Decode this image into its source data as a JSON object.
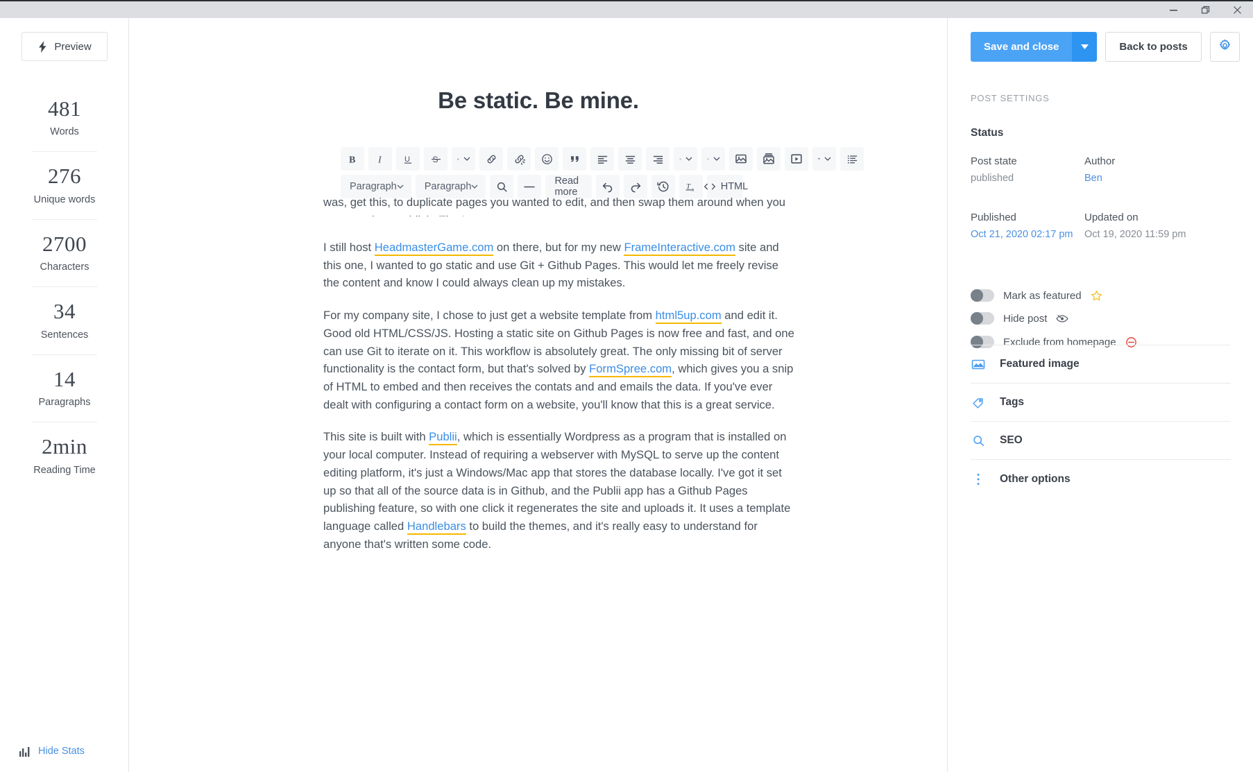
{
  "window": {
    "controls": [
      {
        "name": "minimize",
        "glyph": "minimize-icon"
      },
      {
        "name": "restore",
        "glyph": "restore-icon"
      },
      {
        "name": "close",
        "glyph": "close-icon"
      }
    ]
  },
  "sidebar": {
    "preview_label": "Preview",
    "preview_icon": "lightning-bolt-icon",
    "stats": [
      {
        "value": "481",
        "label": "Words"
      },
      {
        "value": "276",
        "label": "Unique words"
      },
      {
        "value": "2700",
        "label": "Characters"
      },
      {
        "value": "34",
        "label": "Sentences"
      },
      {
        "value": "14",
        "label": "Paragraphs"
      },
      {
        "value": "2min",
        "label": "Reading Time"
      }
    ],
    "hide_stats_label": "Hide Stats",
    "hide_stats_icon": "bar-chart-icon",
    "hide_stats_color": "#4a90e2"
  },
  "editor": {
    "title": "Be static. Be mine.",
    "toolbar": {
      "row1": [
        {
          "name": "bold-button",
          "icon": "bold-icon",
          "label": "B"
        },
        {
          "name": "italic-button",
          "icon": "italic-icon",
          "label": "I"
        },
        {
          "name": "underline-button",
          "icon": "underline-icon",
          "label": "U"
        },
        {
          "name": "strikethrough-button",
          "icon": "strikethrough-icon",
          "label": "S"
        },
        {
          "name": "text-color-button",
          "icon": "text-color-icon",
          "label": "A"
        },
        {
          "name": "insert-link-button",
          "icon": "link-icon",
          "label": ""
        },
        {
          "name": "remove-link-button",
          "icon": "unlink-icon",
          "label": ""
        },
        {
          "name": "emoji-button",
          "icon": "smiley-icon",
          "label": ""
        },
        {
          "name": "blockquote-button",
          "icon": "quote-icon",
          "label": ""
        },
        {
          "name": "align-left-button",
          "icon": "align-left-icon",
          "label": ""
        },
        {
          "name": "align-center-button",
          "icon": "align-center-icon",
          "label": ""
        },
        {
          "name": "align-right-button",
          "icon": "align-right-icon",
          "label": ""
        },
        {
          "name": "bullet-list-button",
          "icon": "bullet-list-icon",
          "label": ""
        },
        {
          "name": "numbered-list-button",
          "icon": "numbered-list-icon",
          "label": ""
        },
        {
          "name": "insert-image-button",
          "icon": "image-icon",
          "label": ""
        },
        {
          "name": "insert-gallery-button",
          "icon": "gallery-icon",
          "label": ""
        },
        {
          "name": "insert-video-button",
          "icon": "video-icon",
          "label": ""
        },
        {
          "name": "insert-table-button",
          "icon": "table-icon",
          "label": ""
        },
        {
          "name": "toc-button",
          "icon": "list-detail-icon",
          "label": ""
        }
      ],
      "row2": {
        "block_format": "Paragraph",
        "text_style": "Paragraph",
        "search_icon": "search-icon",
        "horizontal_rule_icon": "horizontal-rule-icon",
        "read_more_label": "Read more",
        "undo_icon": "undo-icon",
        "redo_icon": "redo-icon",
        "history_icon": "history-clock-icon",
        "clear_formatting_icon": "clear-format-icon",
        "html_label": "HTML",
        "html_icon": "code-brackets-icon"
      }
    },
    "body": {
      "clipped_paragraph": "was, get this, to duplicate pages you wanted to edit, and then swap them around when you were ready to publish. That's crazy.",
      "paragraphs": [
        {
          "runs": [
            {
              "t": "I still host "
            },
            {
              "t": "HeadmasterGame.com",
              "link": true
            },
            {
              "t": " on there, but for my new "
            },
            {
              "t": "FrameInteractive.com",
              "link": true
            },
            {
              "t": " site and this one, I wanted to go static and use Git + Github Pages. This would let me freely revise the content and know I could always clean up my mistakes."
            }
          ]
        },
        {
          "runs": [
            {
              "t": "For my company site, I chose to just get a website template from "
            },
            {
              "t": "html5up.com",
              "link": true
            },
            {
              "t": " and edit it. Good old HTML/CSS/JS. Hosting a static site on Github Pages is now free and fast, and one can use Git to iterate on it. This workflow is absolutely great. The only missing bit of server functionality is the contact form, but that's solved by "
            },
            {
              "t": "FormSpree.com",
              "link": true
            },
            {
              "t": ", which gives you a snip of HTML to embed and then receives the contats and and emails the data. If you've ever dealt with configuring a contact form on a website, you'll know that this is a great service."
            }
          ]
        },
        {
          "runs": [
            {
              "t": "This site is built with "
            },
            {
              "t": "Publii",
              "link": true
            },
            {
              "t": ", which is essentially Wordpress as a program that is installed on your local computer. Instead of requiring a webserver with MySQL to serve up the content editing platform, it's just a Windows/Mac app that stores the database locally. I've got it set up so that all of the source data is in Github, and the Publii app has a Github Pages publishing feature, so with one click it regenerates the site and uploads it. It uses a template language called "
            },
            {
              "t": "Handlebars",
              "link": true
            },
            {
              "t": " to build the themes, and it's really easy to understand for anyone that's written some code."
            }
          ]
        }
      ],
      "link_underline_color": "#f5b800",
      "link_text_color": "#3a8ee6"
    }
  },
  "settings": {
    "save_and_close_label": "Save and close",
    "save_and_close_color": "#4aa3f5",
    "back_to_posts_label": "Back to posts",
    "gear_icon": "gear-icon",
    "heading": "POST SETTINGS",
    "status_heading": "Status",
    "post_state_label": "Post state",
    "post_state_value": "published",
    "author_label": "Author",
    "author_value": "Ben",
    "published_label": "Published",
    "published_value": "Oct 21, 2020 02:17 pm",
    "updated_label": "Updated on",
    "updated_value": "Oct 19, 2020 11:59 pm",
    "toggles": [
      {
        "name": "mark-as-featured",
        "label": "Mark as featured",
        "icon": "star-icon",
        "icon_color": "#f5c226",
        "on": false
      },
      {
        "name": "hide-post",
        "label": "Hide post",
        "icon": "eye-slash-icon",
        "icon_color": "#5c636d",
        "on": false
      },
      {
        "name": "exclude-from-homepage",
        "label": "Exclude from homepage",
        "icon": "no-entry-icon",
        "icon_color": "#e8453c",
        "on": false
      }
    ],
    "sections": [
      {
        "name": "featured-image",
        "label": "Featured image",
        "icon": "image-frame-icon"
      },
      {
        "name": "tags",
        "label": "Tags",
        "icon": "tag-icon"
      },
      {
        "name": "seo",
        "label": "SEO",
        "icon": "magnifier-icon"
      },
      {
        "name": "other-options",
        "label": "Other options",
        "icon": "vertical-dots-icon"
      }
    ]
  }
}
